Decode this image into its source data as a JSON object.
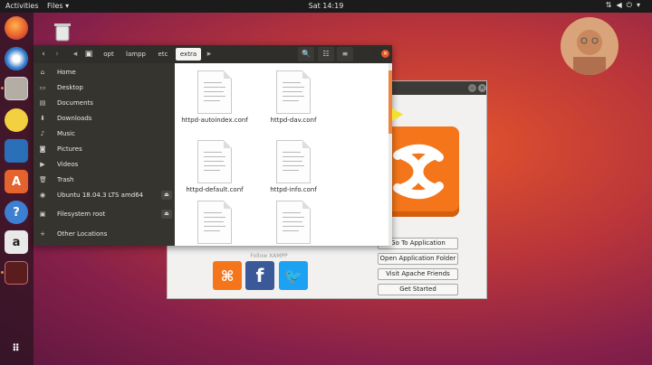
{
  "topbar": {
    "activities": "Activities",
    "app_menu": "Files",
    "clock": "Sat 14:19"
  },
  "files_window": {
    "breadcrumbs": [
      "opt",
      "lampp",
      "etc",
      "extra"
    ],
    "sidebar": [
      {
        "label": "Home",
        "icon": "home-icon"
      },
      {
        "label": "Desktop",
        "icon": "desktop-icon"
      },
      {
        "label": "Documents",
        "icon": "documents-icon"
      },
      {
        "label": "Downloads",
        "icon": "downloads-icon"
      },
      {
        "label": "Music",
        "icon": "music-icon"
      },
      {
        "label": "Pictures",
        "icon": "pictures-icon"
      },
      {
        "label": "Videos",
        "icon": "videos-icon"
      },
      {
        "label": "Trash",
        "icon": "trash-icon"
      },
      {
        "label": "Ubuntu 18.04.3 LTS amd64",
        "icon": "disc-icon"
      },
      {
        "label": "Filesystem root",
        "icon": "drive-icon"
      },
      {
        "label": "Other Locations",
        "icon": "plus-icon"
      }
    ],
    "files": [
      "httpd-autoindex.conf",
      "httpd-dav.conf",
      "httpd-default.conf",
      "httpd-info.conf",
      "",
      ""
    ]
  },
  "xampp_window": {
    "follow": "Follow XAMPP",
    "buttons": [
      "Go To Application",
      "Open Application Folder",
      "Visit Apache Friends",
      "Get Started"
    ]
  },
  "colors": {
    "accent": "#f0843f",
    "xampp_orange": "#f4751a",
    "facebook_blue": "#3b5998",
    "twitter_blue": "#1da1f2"
  }
}
